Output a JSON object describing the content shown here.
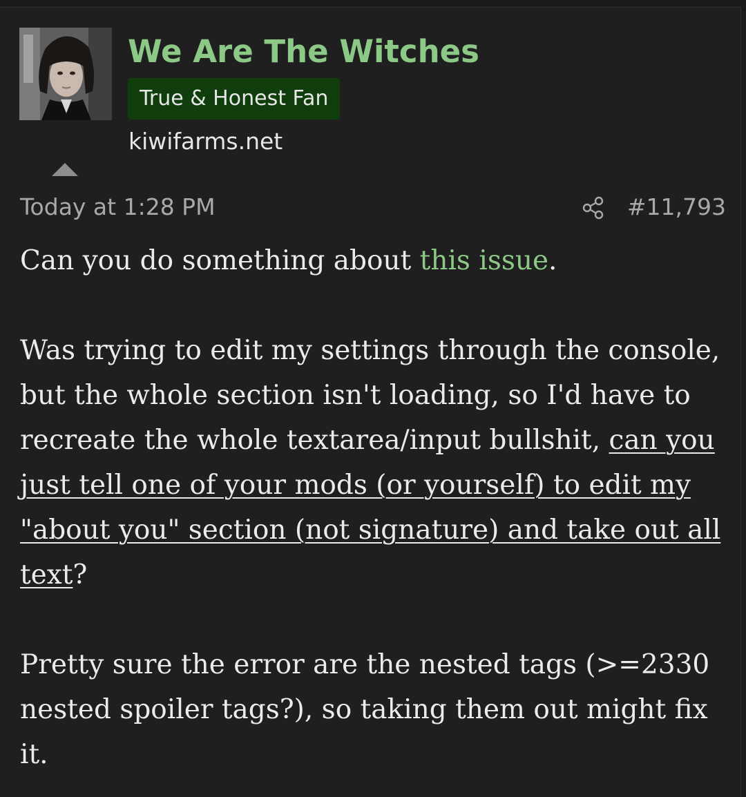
{
  "user": {
    "name": "We Are The Witches",
    "title": "True & Honest Fan",
    "site": "kiwifarms.net"
  },
  "post": {
    "date": "Today at 1:28 PM",
    "number": "#11,793",
    "p1_before": "Can you do something about ",
    "p1_link": "this issue",
    "p1_after": ".",
    "p2_plain": "Was trying to edit my settings through the console, but the whole section isn't loading, so I'd have to recreate the whole textarea/input bullshit, ",
    "p2_underlined": "can you just tell one of your mods (or yourself) to edit my \"about you\" section (not signature) and take out all text",
    "p2_end": "?",
    "p3": "Pretty sure the error are the nested tags (>=2330 nested spoiler tags?), so taking them out might fix it."
  },
  "colors": {
    "background": "#1f1f1f",
    "username": "#8cc886",
    "badge": "#0f3d0b",
    "link": "#8cc886",
    "meta_text": "#a9a9a9",
    "body_text": "#ebebeb"
  },
  "icons": {
    "share": "share-icon",
    "collapse": "collapse-arrow-icon"
  }
}
